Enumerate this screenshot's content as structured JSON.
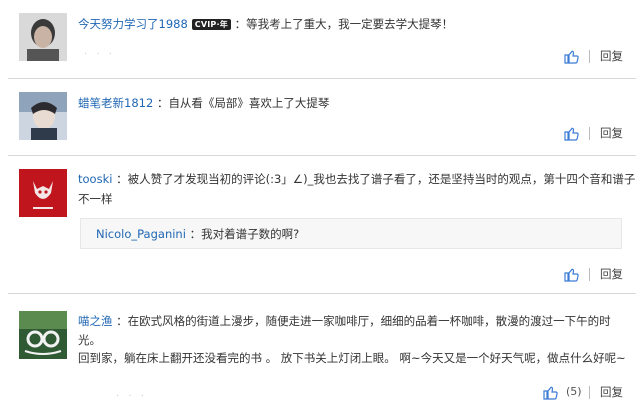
{
  "comments": [
    {
      "username": "今天努力学习了1988",
      "vip_badge": "CVIP·年",
      "separator": "：",
      "text": "等我考上了重大，我一定要去学大提琴！",
      "reply_label": "回复"
    },
    {
      "username": "蜡笔老新1812",
      "separator": "：",
      "text": "自从看《局部》喜欢上了大提琴",
      "reply_label": "回复"
    },
    {
      "username": "tooski",
      "separator": "：",
      "text_line1": "被人赞了才发现当初的评论(:3」∠)_我也去找了谱子看了，还是坚持当时的观点，第十四个音和谱子",
      "text_line2": "不一样",
      "reply": {
        "username": "Nicolo_Paganini",
        "separator": "：",
        "text": "我对着谱子数的啊?"
      },
      "reply_label": "回复"
    },
    {
      "username": "喵之渔",
      "separator": "：",
      "text_line1": "在欧式风格的街道上漫步，随便走进一家咖啡厅，细细的品着一杯咖啡，散漫的渡过一下午的时",
      "text_line2": "光。",
      "text_line3": "回到家，躺在床上翻开还没看完的书 。 放下书关上灯闭上眼。 啊~今天又是一个好天气呢，做点什么好呢~",
      "like_count": "(5)",
      "reply_label": "回复"
    }
  ],
  "colors": {
    "username": "#1f66b3",
    "thumb": "#3a7bd5",
    "divider": "#d8d8d8"
  }
}
